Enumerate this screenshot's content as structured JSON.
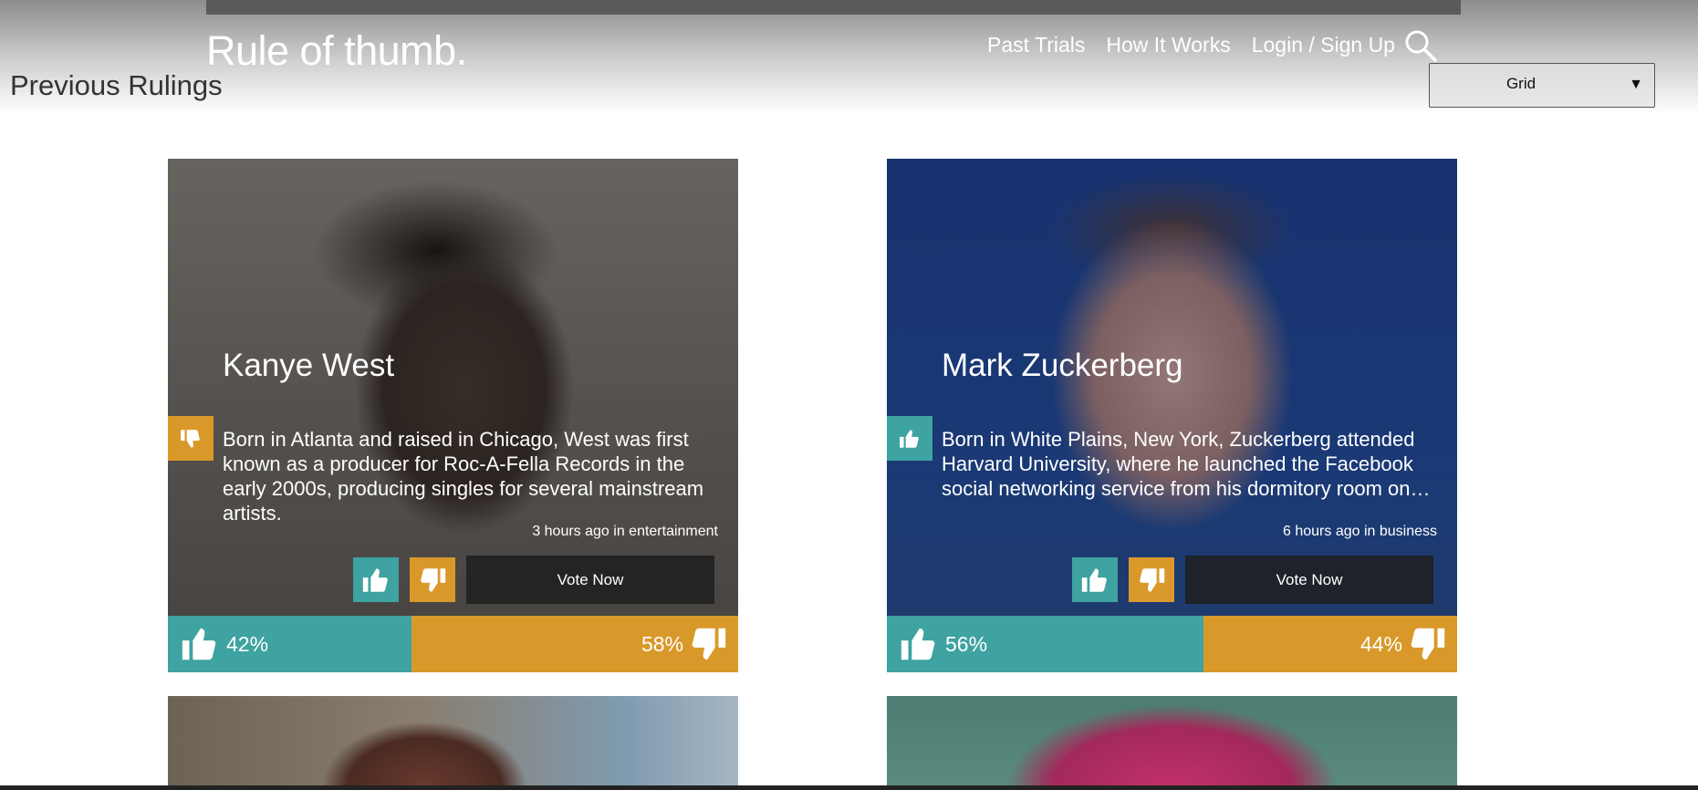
{
  "header": {
    "logo": "Rule of thumb.",
    "nav": [
      "Past Trials",
      "How It Works",
      "Login / Sign Up"
    ]
  },
  "page": {
    "title": "Previous Rulings",
    "view_select": {
      "value": "Grid"
    }
  },
  "cards": [
    {
      "name": "Kanye West",
      "description": "Born in Atlanta and raised in Chicago, West was first known as a producer for Roc-A-Fella Records in the early 2000s, producing singles for several mainstream artists.",
      "meta": "3 hours ago in entertainment",
      "badge": "thumbs-down",
      "vote_label": "Vote Now",
      "positive_pct": "42%",
      "negative_pct": "58%",
      "positive_share": 0.42
    },
    {
      "name": "Mark Zuckerberg",
      "description": "Born in White Plains, New York, Zuckerberg attended Harvard University, where he launched the Facebook social networking service from his dormitory room on…",
      "meta": "6 hours ago in business",
      "badge": "thumbs-up",
      "vote_label": "Vote Now",
      "positive_pct": "56%",
      "negative_pct": "44%",
      "positive_share": 0.56
    }
  ],
  "colors": {
    "positive": "#3ea3a1",
    "negative": "#d9992a"
  }
}
